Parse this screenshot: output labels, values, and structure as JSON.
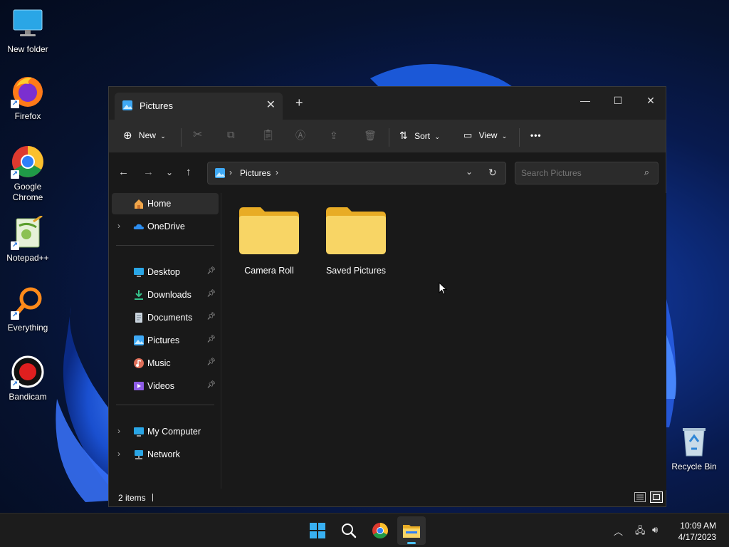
{
  "desktop": {
    "icons": [
      {
        "label": "New folder",
        "icon": "monitor-icon"
      },
      {
        "label": "Firefox",
        "icon": "firefox-icon"
      },
      {
        "label": "Google Chrome",
        "icon": "chrome-icon"
      },
      {
        "label": "Notepad++",
        "icon": "notepadpp-icon"
      },
      {
        "label": "Everything",
        "icon": "everything-icon"
      },
      {
        "label": "Bandicam",
        "icon": "bandicam-icon"
      },
      {
        "label": "Recycle Bin",
        "icon": "recycle-bin-icon"
      }
    ]
  },
  "window": {
    "tab_title": "Pictures",
    "toolbar": {
      "new_label": "New",
      "sort_label": "Sort",
      "view_label": "View",
      "more_label": "•••"
    },
    "address": {
      "segment": "Pictures"
    },
    "search": {
      "placeholder": "Search Pictures"
    },
    "sidebar": {
      "items": [
        {
          "label": "Home"
        },
        {
          "label": "OneDrive"
        },
        {
          "label": "Desktop"
        },
        {
          "label": "Downloads"
        },
        {
          "label": "Documents"
        },
        {
          "label": "Pictures"
        },
        {
          "label": "Music"
        },
        {
          "label": "Videos"
        },
        {
          "label": "My Computer"
        },
        {
          "label": "Network"
        }
      ]
    },
    "content": {
      "items": [
        {
          "label": "Camera Roll"
        },
        {
          "label": "Saved Pictures"
        }
      ]
    },
    "status": {
      "count": "2 items"
    }
  },
  "taskbar": {
    "clock_time": "10:09 AM",
    "clock_date": "4/17/2023"
  },
  "colors": {
    "folder": "#f5c343",
    "accent": "#4cc2ff"
  }
}
